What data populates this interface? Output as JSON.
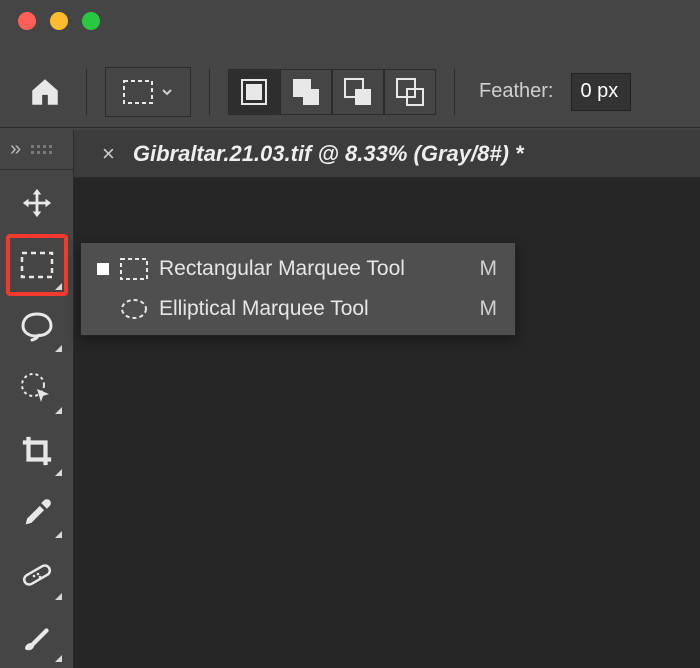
{
  "tab": {
    "title": "Gibraltar.21.03.tif @ 8.33% (Gray/8#) *"
  },
  "options": {
    "feather_label": "Feather:",
    "feather_value": "0 px"
  },
  "flyout": {
    "items": [
      {
        "label": "Rectangular Marquee Tool",
        "shortcut": "M",
        "active": true,
        "shape": "rect"
      },
      {
        "label": "Elliptical Marquee Tool",
        "shortcut": "M",
        "active": false,
        "shape": "ellipse"
      }
    ]
  },
  "tools": [
    {
      "id": "move",
      "name": "move-tool"
    },
    {
      "id": "marquee",
      "name": "marquee-tool",
      "highlighted": true
    },
    {
      "id": "lasso",
      "name": "lasso-tool"
    },
    {
      "id": "quickselect",
      "name": "quick-select-tool"
    },
    {
      "id": "crop",
      "name": "crop-tool"
    },
    {
      "id": "eyedropper",
      "name": "eyedropper-tool"
    },
    {
      "id": "heal",
      "name": "spot-heal-tool"
    },
    {
      "id": "brush",
      "name": "brush-tool"
    }
  ]
}
